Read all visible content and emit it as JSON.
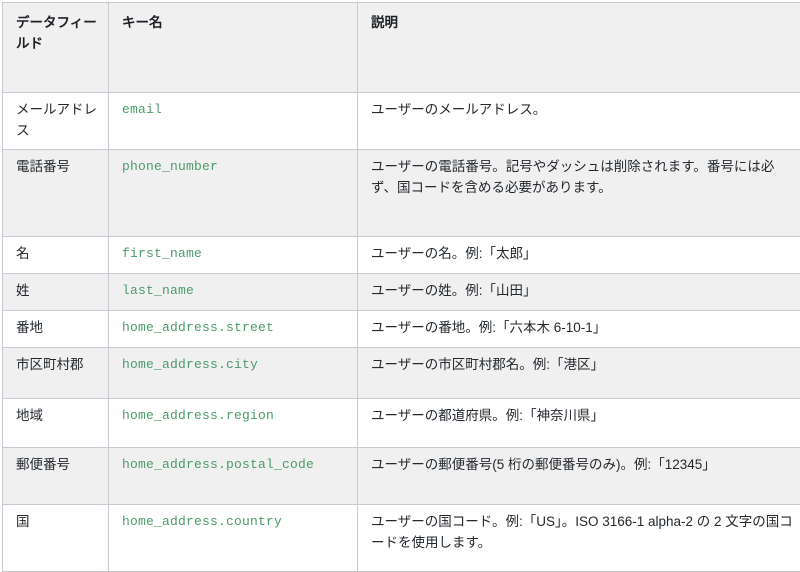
{
  "table": {
    "headers": [
      {
        "label": "データフィールド",
        "name": "header-data-field"
      },
      {
        "label": "キー名",
        "name": "header-key-name"
      },
      {
        "label": "説明",
        "name": "header-description"
      }
    ],
    "rows": [
      {
        "field": "メールアドレス",
        "key": "email",
        "description": "ユーザーのメールアドレス。",
        "shaded": false
      },
      {
        "field": "電話番号",
        "key": "phone_number",
        "description": "ユーザーの電話番号。記号やダッシュは削除されます。番号には必ず、国コードを含める必要があります。",
        "shaded": true
      },
      {
        "field": "名",
        "key": "first_name",
        "description": "ユーザーの名。例:「太郎」",
        "shaded": false
      },
      {
        "field": "姓",
        "key": "last_name",
        "description": "ユーザーの姓。例:「山田」",
        "shaded": true
      },
      {
        "field": "番地",
        "key": "home_address.street",
        "description": "ユーザーの番地。例:「六本木 6-10-1」",
        "shaded": false
      },
      {
        "field": "市区町村郡",
        "key": "home_address.city",
        "description": "ユーザーの市区町村郡名。例:「港区」",
        "shaded": true
      },
      {
        "field": "地域",
        "key": "home_address.region",
        "description": "ユーザーの都道府県。例:「神奈川県」",
        "shaded": false
      },
      {
        "field": "郵便番号",
        "key": "home_address.postal_code",
        "description": "ユーザーの郵便番号(5 桁の郵便番号のみ)。例:「12345」",
        "shaded": true
      },
      {
        "field": "国",
        "key": "home_address.country",
        "description": "ユーザーの国コード。例:「US」。ISO 3166-1 alpha-2 の 2 文字の国コードを使用します。",
        "shaded": false
      }
    ]
  },
  "colors": {
    "header_background": "#f0f0f0",
    "row_shade_background": "#f0f0f0",
    "row_plain_background": "#ffffff",
    "border": "#c6cbd1",
    "key_text": "#4c9a6b",
    "body_text": "#24292e"
  }
}
